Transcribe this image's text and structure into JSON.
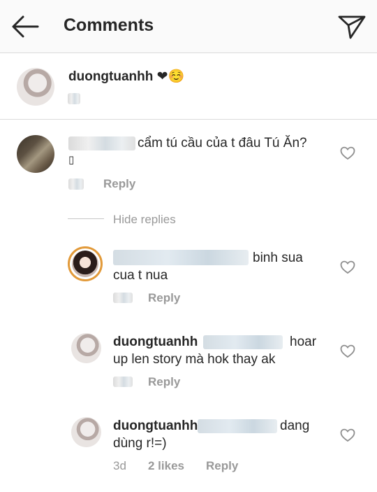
{
  "header": {
    "title": "Comments",
    "back_icon": "back-arrow-icon",
    "send_icon": "direct-message-icon"
  },
  "caption": {
    "username": "duongtuanhh",
    "emoji": "❤☺️"
  },
  "comments": [
    {
      "text": "cẩm tú cầu của t đâu Tú Ăn?",
      "extra_glyph": "▯",
      "reply_label": "Reply",
      "hide_replies_label": "Hide replies"
    }
  ],
  "replies": [
    {
      "text_line1": "binh sua",
      "text_line2": "cua t nua",
      "reply_label": "Reply"
    },
    {
      "username": "duongtuanhh",
      "text_line1": "hoar",
      "text_line2": "up len story mà hok thay ak",
      "reply_label": "Reply"
    },
    {
      "username": "duongtuanhh",
      "text_line1": "dang",
      "text_line2": "dùng r!=)",
      "time": "3d",
      "likes": "2 likes",
      "reply_label": "Reply"
    }
  ],
  "colors": {
    "header_bg": "#fafafa",
    "text": "#262626",
    "secondary": "#999999",
    "story_ring": "#e29a3a"
  }
}
